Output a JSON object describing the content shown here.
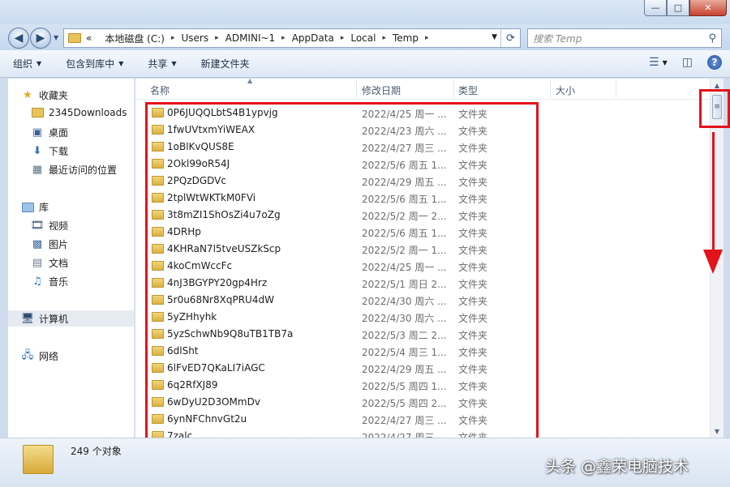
{
  "window": {
    "minimize_glyph": "—",
    "maximize_glyph": "□",
    "close_glyph": "✕"
  },
  "address": {
    "prefix": "«",
    "crumbs": [
      "本地磁盘 (C:)",
      "Users",
      "ADMINI~1",
      "AppData",
      "Local",
      "Temp"
    ],
    "separator": "▸",
    "search_placeholder": "搜索 Temp"
  },
  "toolbar": {
    "organize": "组织",
    "include_in_library": "包含到库中",
    "share": "共享",
    "new_folder": "新建文件夹"
  },
  "nav": {
    "favorites": "收藏夹",
    "downloads_2345": "2345Downloads",
    "desktop": "桌面",
    "downloads": "下载",
    "recent": "最近访问的位置",
    "libraries": "库",
    "videos": "视频",
    "pictures": "图片",
    "documents": "文档",
    "music": "音乐",
    "computer": "计算机",
    "network": "网络"
  },
  "columns": {
    "name": "名称",
    "date": "修改日期",
    "type": "类型",
    "size": "大小"
  },
  "files": [
    {
      "name": "0P6JUQQLbtS4B1ypvjg",
      "date": "2022/4/25 周一 ...",
      "type": "文件夹"
    },
    {
      "name": "1fwUVtxmYiWEAX",
      "date": "2022/4/23 周六 ...",
      "type": "文件夹"
    },
    {
      "name": "1oBlKvQUS8E",
      "date": "2022/4/27 周三 ...",
      "type": "文件夹"
    },
    {
      "name": "2Okl99oR54J",
      "date": "2022/5/6 周五 1...",
      "type": "文件夹"
    },
    {
      "name": "2PQzDGDVc",
      "date": "2022/4/29 周五 ...",
      "type": "文件夹"
    },
    {
      "name": "2tplWtWKTkM0FVi",
      "date": "2022/5/6 周五 1...",
      "type": "文件夹"
    },
    {
      "name": "3t8mZI1ShOsZi4u7oZg",
      "date": "2022/5/2 周一 2...",
      "type": "文件夹"
    },
    {
      "name": "4DRHp",
      "date": "2022/5/6 周五 1...",
      "type": "文件夹"
    },
    {
      "name": "4KHRaN7l5tveUSZkScp",
      "date": "2022/5/2 周一 1...",
      "type": "文件夹"
    },
    {
      "name": "4koCmWccFc",
      "date": "2022/4/25 周一 ...",
      "type": "文件夹"
    },
    {
      "name": "4nJ3BGYPY20gp4Hrz",
      "date": "2022/5/1 周日 2...",
      "type": "文件夹"
    },
    {
      "name": "5r0u68Nr8XqPRU4dW",
      "date": "2022/4/30 周六 ...",
      "type": "文件夹"
    },
    {
      "name": "5yZHhyhk",
      "date": "2022/4/30 周六 ...",
      "type": "文件夹"
    },
    {
      "name": "5yzSchwNb9Q8uTB1TB7a",
      "date": "2022/5/3 周二 2...",
      "type": "文件夹"
    },
    {
      "name": "6dlSht",
      "date": "2022/5/4 周三 1...",
      "type": "文件夹"
    },
    {
      "name": "6lFvED7QKaLI7iAGC",
      "date": "2022/4/29 周五 ...",
      "type": "文件夹"
    },
    {
      "name": "6q2RfXJ89",
      "date": "2022/5/5 周四 1...",
      "type": "文件夹"
    },
    {
      "name": "6wDyU2D3OMmDv",
      "date": "2022/5/5 周四 2...",
      "type": "文件夹"
    },
    {
      "name": "6ynNFChnvGt2u",
      "date": "2022/4/27 周三 ...",
      "type": "文件夹"
    },
    {
      "name": "7zalc",
      "date": "2022/4/27 周三 ...",
      "type": "文件夹"
    }
  ],
  "status": {
    "count": "249 个对象",
    "watermark": "头条 @鑫荣电脑技术"
  }
}
